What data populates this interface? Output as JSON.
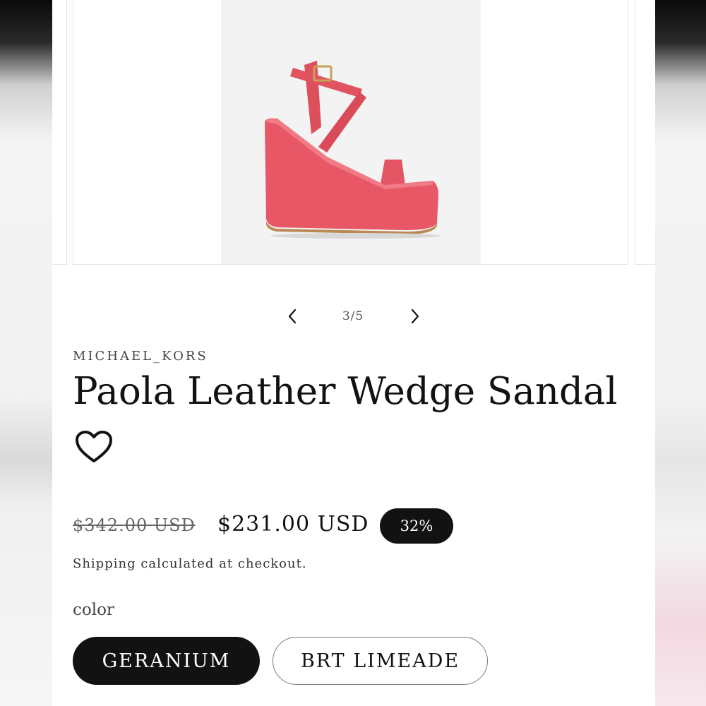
{
  "gallery": {
    "counter": "3/5",
    "image_alt": "Paola Leather Wedge Sandal in geranium",
    "prev_icon": "chevron-left-icon",
    "next_icon": "chevron-right-icon"
  },
  "product": {
    "vendor": "MICHAEL_KORS",
    "title": "Paola Leather Wedge Sandal",
    "wishlist_icon": "heart-outline-icon",
    "price_compare": "$342.00 USD",
    "price_sale": "$231.00 USD",
    "discount_badge": "32%",
    "shipping_note": "Shipping calculated at checkout."
  },
  "options": {
    "label": "color",
    "values": [
      "GERANIUM",
      "BRT LIMEADE"
    ],
    "selected": "GERANIUM"
  },
  "colors": {
    "sandal": "#e2525f",
    "dark": "#121212",
    "gold": "#c9a15a"
  }
}
